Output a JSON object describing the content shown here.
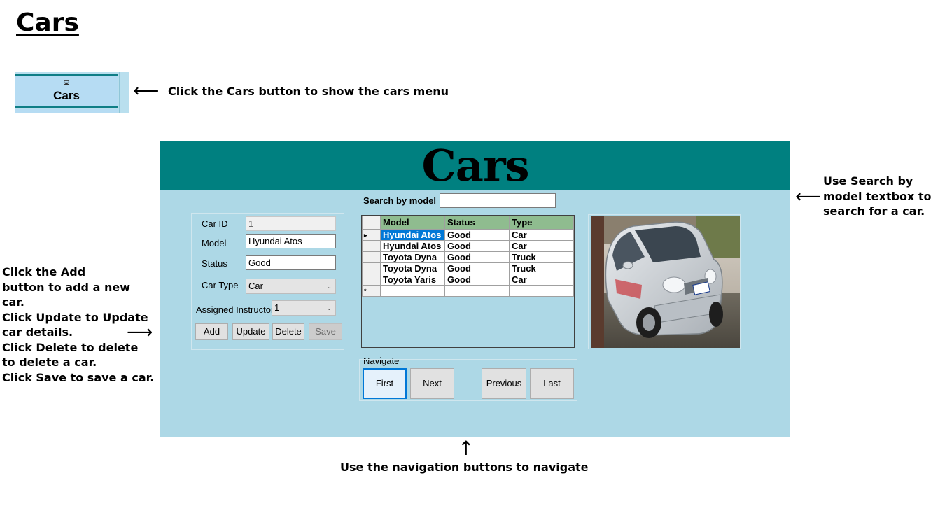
{
  "page": {
    "title": "Cars"
  },
  "sidebar_crop": {
    "cars_button_label": "Cars",
    "car_icon": "car-icon"
  },
  "annotations": {
    "cars_button_note": "Click the Cars button to show the cars menu",
    "search_note_lines": [
      "Use Search by",
      "model textbox to",
      "search for a car."
    ],
    "crud_note_lines": [
      "Click the Add",
      "button to add a new",
      "car.",
      "Click Update to Update",
      "car details.",
      "Click Delete to delete",
      "to delete a car.",
      "Click Save to save a car."
    ],
    "navigation_note": "Use the navigation buttons to navigate",
    "arrow_left": "⟵",
    "arrow_right": "⟶",
    "arrow_up": "↑"
  },
  "app": {
    "header_title": "Cars",
    "search": {
      "label": "Search by model",
      "value": ""
    },
    "form": {
      "car_id_label": "Car ID",
      "car_id_value": "1",
      "model_label": "Model",
      "model_value": "Hyundai Atos",
      "status_label": "Status",
      "status_value": "Good",
      "car_type_label": "Car Type",
      "car_type_value": "Car",
      "instructor_label": "Assigned Instructor",
      "instructor_value": "1"
    },
    "buttons": {
      "add": "Add",
      "update": "Update",
      "delete": "Delete",
      "save": "Save"
    },
    "grid": {
      "columns": [
        "Model",
        "Status",
        "Type"
      ],
      "rows": [
        [
          "Hyundai Atos",
          "Good",
          "Car"
        ],
        [
          "Hyundai Atos",
          "Good",
          "Car"
        ],
        [
          "Toyota Dyna",
          "Good",
          "Truck"
        ],
        [
          "Toyota Dyna",
          "Good",
          "Truck"
        ],
        [
          "Toyota Yaris",
          "Good",
          "Car"
        ]
      ],
      "current_row_marker": "▸",
      "new_row_marker": "*"
    },
    "navigate": {
      "group_label": "Navigate",
      "first": "First",
      "next": "Next",
      "previous": "Previous",
      "last": "Last"
    },
    "colors": {
      "header": "#008080",
      "body": "#add8e6",
      "grid_header": "#8fbc8f",
      "selection": "#0078d7"
    }
  }
}
